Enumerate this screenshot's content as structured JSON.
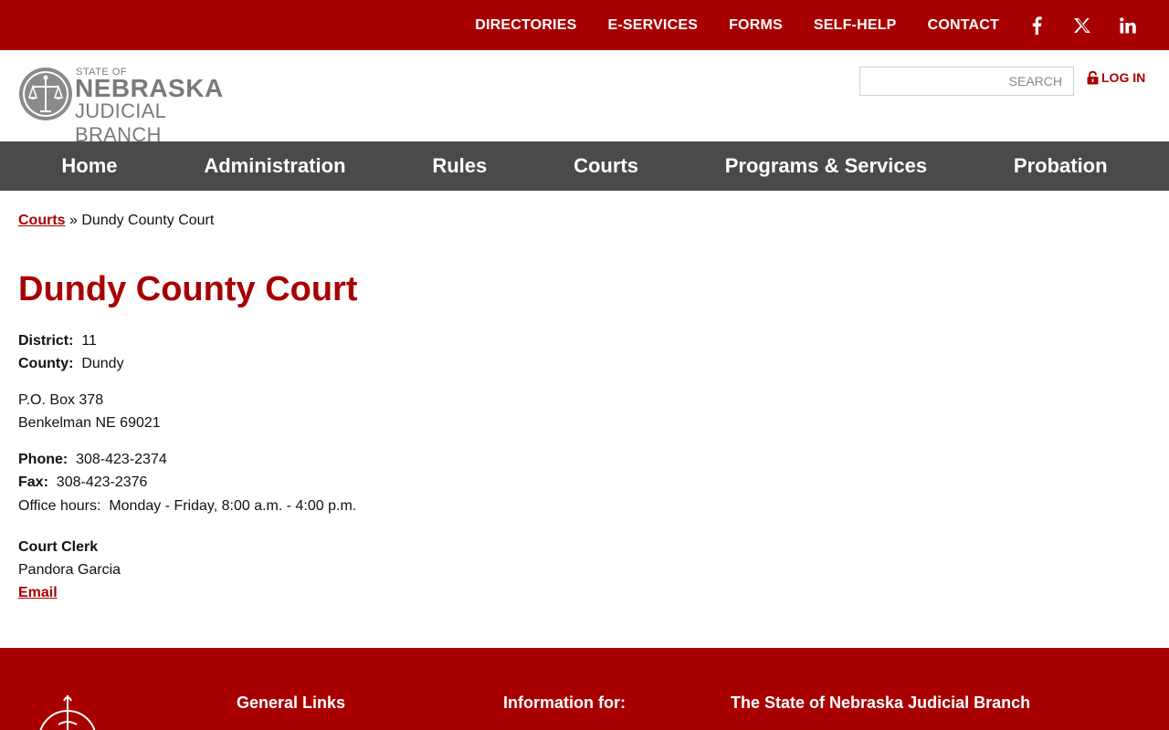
{
  "topbar": {
    "links": [
      "DIRECTORIES",
      "E-SERVICES",
      "FORMS",
      "SELF-HELP",
      "CONTACT"
    ],
    "social": [
      "facebook-icon",
      "x-icon",
      "linkedin-icon"
    ]
  },
  "logo": {
    "line1": "STATE OF",
    "line2": "NEBRASKA",
    "line3": "JUDICIAL BRANCH"
  },
  "search": {
    "placeholder": "SEARCH"
  },
  "login": {
    "label": "LOG IN"
  },
  "nav": [
    "Home",
    "Administration",
    "Rules",
    "Courts",
    "Programs & Services",
    "Probation"
  ],
  "breadcrumb": {
    "link": "Courts",
    "separator": " » ",
    "current": "Dundy County Court"
  },
  "page": {
    "title": "Dundy County Court",
    "district_label": "District:",
    "district": "11",
    "county_label": "County:",
    "county": "Dundy",
    "address1": "P.O. Box 378",
    "address2": "Benkelman NE 69021",
    "phone_label": "Phone:",
    "phone": "308-423-2374",
    "fax_label": "Fax:",
    "fax": "308-423-2376",
    "hours_label": "Office hours:",
    "hours": "Monday - Friday, 8:00 a.m. - 4:00 p.m.",
    "clerk_label": "Court Clerk",
    "clerk_name": "Pandora Garcia",
    "email_link": "Email"
  },
  "footer": {
    "col1": "General Links",
    "col2": "Information for:",
    "col3": "The State of Nebraska Judicial Branch"
  },
  "colors": {
    "brand_red": "#a80000",
    "nav_gray": "#4a4a4a"
  }
}
